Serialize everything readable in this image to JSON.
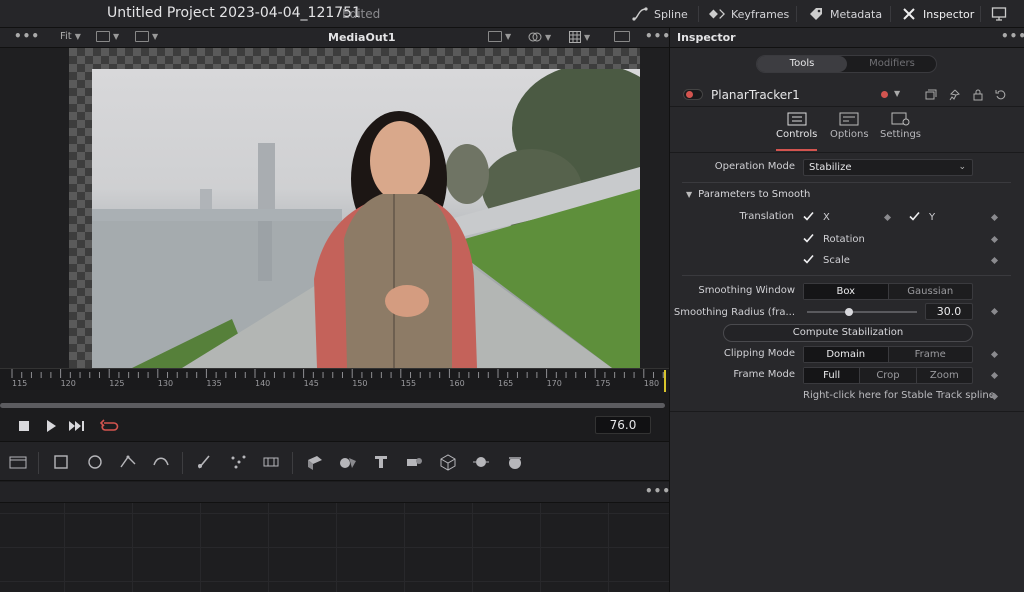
{
  "app": {
    "project_title": "Untitled Project 2023-04-04_121751",
    "project_status": "Edited"
  },
  "top_toolbar": {
    "spline": "Spline",
    "keyframes": "Keyframes",
    "metadata": "Metadata",
    "inspector": "Inspector"
  },
  "viewer": {
    "more": "•••",
    "fit_label": "Fit",
    "title": "MediaOut1",
    "more_right": "•••"
  },
  "timeline": {
    "ticks": [
      "115",
      "120",
      "125",
      "130",
      "135",
      "140",
      "145",
      "150",
      "155",
      "160",
      "165",
      "170",
      "175",
      "180"
    ],
    "current_frame": "76.0"
  },
  "nodes": {
    "more": "•••"
  },
  "inspector": {
    "title": "Inspector",
    "more": "•••",
    "tabs": {
      "tools": "Tools",
      "modifiers": "Modifiers"
    },
    "node_name": "PlanarTracker1",
    "sub_tabs": {
      "controls": "Controls",
      "options": "Options",
      "settings": "Settings"
    },
    "operation_mode_label": "Operation Mode",
    "operation_mode_value": "Stabilize",
    "section_title": "Parameters to Smooth",
    "translation_label": "Translation",
    "x_label": "X",
    "y_label": "Y",
    "rotation_label": "Rotation",
    "scale_label": "Scale",
    "smoothing_window_label": "Smoothing Window",
    "smoothing_window_options": [
      "Box",
      "Gaussian"
    ],
    "smoothing_radius_label": "Smoothing Radius (fra...",
    "smoothing_radius_value": "30.0",
    "smoothing_radius_level": 0.38,
    "compute_button": "Compute Stabilization",
    "clipping_mode_label": "Clipping Mode",
    "clipping_mode_options": [
      "Domain",
      "Frame"
    ],
    "frame_mode_label": "Frame Mode",
    "frame_mode_options": [
      "Full",
      "Crop",
      "Zoom"
    ],
    "right_click_hint": "Right-click here for Stable Track spline"
  },
  "colors": {
    "accent": "#d3544f",
    "playhead": "#d8c42b"
  }
}
